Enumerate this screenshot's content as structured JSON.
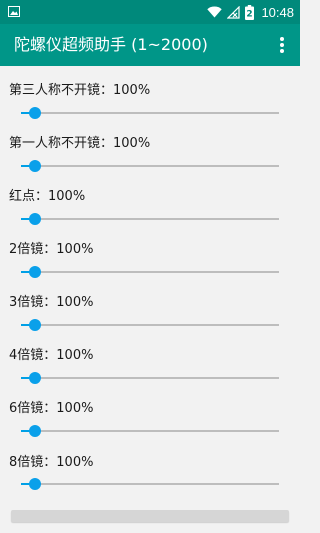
{
  "status_bar": {
    "time": "10:48",
    "battery_level_text": "2",
    "icons": [
      "image-notification-icon",
      "wifi-icon",
      "no-signal-icon",
      "battery-charging-icon"
    ]
  },
  "app_bar": {
    "title": "陀螺仪超频助手 (1~2000)",
    "overflow_icon": "more-vertical-icon"
  },
  "settings": [
    {
      "label": "第三人称不开镜：100%",
      "value_fraction": 0.0
    },
    {
      "label": "第一人称不开镜：100%",
      "value_fraction": 0.0
    },
    {
      "label": "红点：100%",
      "value_fraction": 0.0
    },
    {
      "label": "2倍镜：100%",
      "value_fraction": 0.0
    },
    {
      "label": "3倍镜：100%",
      "value_fraction": 0.0
    },
    {
      "label": "4倍镜：100%",
      "value_fraction": 0.0
    },
    {
      "label": "6倍镜：100%",
      "value_fraction": 0.0
    },
    {
      "label": "8倍镜：100%",
      "value_fraction": 0.0
    }
  ],
  "colors": {
    "status_bar": "#00897b",
    "app_bar": "#009688",
    "slider_accent": "#0aa0ea",
    "slider_track": "#bdbdbd",
    "background": "#f2f2f2"
  }
}
